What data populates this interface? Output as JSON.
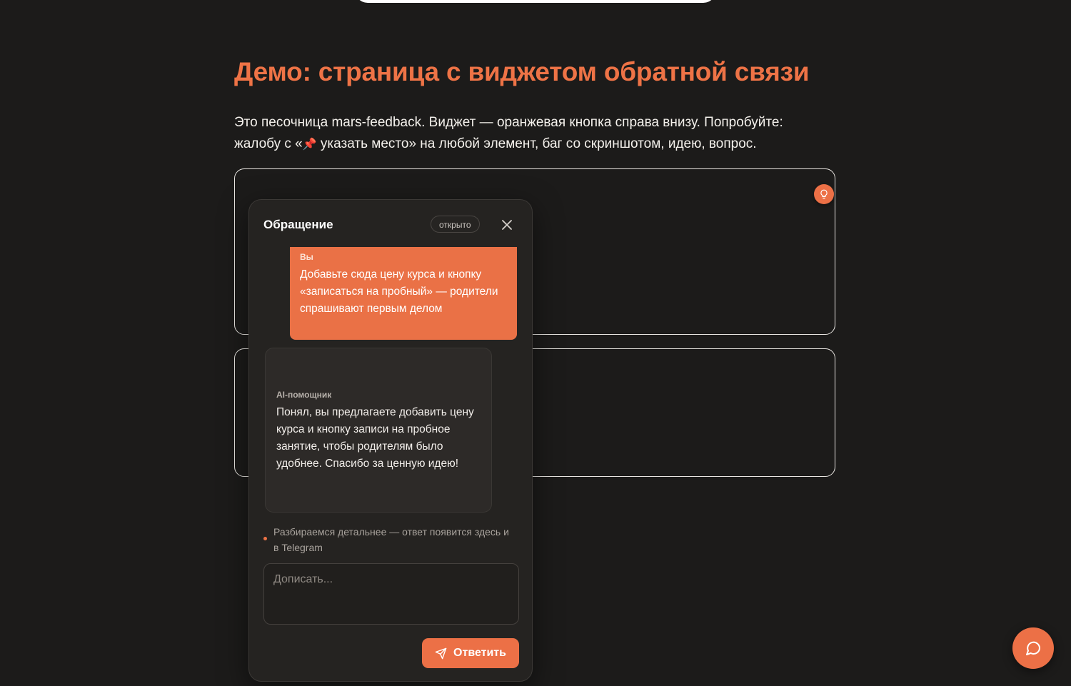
{
  "page": {
    "title": "Демо: страница с виджетом обратной связи",
    "intro_part1": "Это песочница mars-feedback. Виджет — оранжевая кнопка справа внизу. Попробуйте: жалобу с «",
    "intro_pin_icon": "📌",
    "intro_part2": " указать место» на любой элемент, баг со скриншотом, идею, вопрос."
  },
  "panel": {
    "title": "Обращение",
    "status": "открыто",
    "messages": [
      {
        "author": "Вы",
        "text": "Добавьте сюда цену курса и кнопку «записаться на пробный» — родители спрашивают первым делом"
      },
      {
        "author": "AI-помощник",
        "text": "Понял, вы предлагаете добавить цену курса и кнопку записи на пробное занятие, чтобы родителям было удобнее. Спасибо за ценную идею!"
      }
    ],
    "status_text": "Разбираемся детальнее — ответ появится здесь и в Telegram",
    "input_placeholder": "Дописать...",
    "send_label": "Ответить"
  },
  "icons": {
    "hint": "lightbulb-icon",
    "close": "close-icon",
    "send": "send-icon",
    "fab": "chat-bubble-icon"
  },
  "colors": {
    "accent": "#ec7046",
    "background": "#1c1b1a",
    "panel": "#252321"
  }
}
